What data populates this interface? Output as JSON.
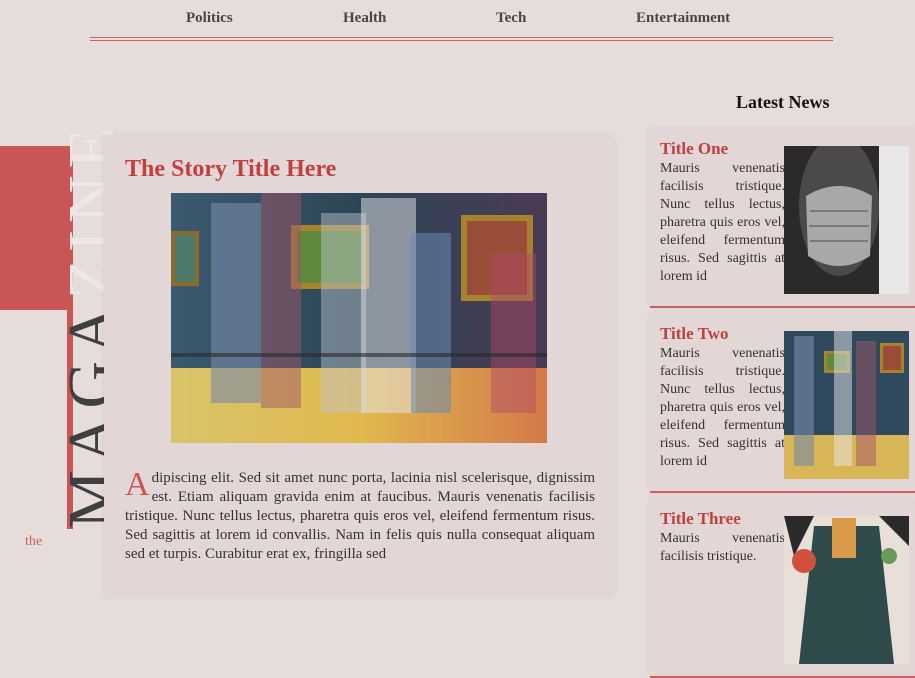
{
  "nav": {
    "items": [
      {
        "label": "Politics"
      },
      {
        "label": "Health"
      },
      {
        "label": "Tech"
      },
      {
        "label": "Entertainment"
      }
    ]
  },
  "masthead": {
    "word_dark": "MAGA",
    "word_light": "ZINE",
    "the": "the"
  },
  "story": {
    "title": "The Story Title Here",
    "dropcap": "A",
    "text": "dipiscing elit. Sed sit amet nunc porta, lacinia nisl scelerisque, dignissim est. Etiam aliquam gravida enim at faucibus. Mauris venenatis facilisis tristique. Nunc tellus lectus, pharetra quis eros vel, eleifend fermentum risus. Sed sagittis at lorem id convallis. Nam in felis quis nulla consequat aliquam sed et turpis. Curabitur erat ex, fringilla sed"
  },
  "sidebar": {
    "heading": "Latest News",
    "items": [
      {
        "title": "Title One",
        "body": "Mauris venenatis facilisis tristique. Nunc tellus lectus, pharetra quis eros vel, eleifend fermentum risus. Sed sagittis at lorem id"
      },
      {
        "title": "Title Two",
        "body": "Mauris venenatis facilisis tristique. Nunc tellus lectus, pharetra quis eros vel, eleifend fermentum risus. Sed sagittis at lorem id"
      },
      {
        "title": "Title Three",
        "body": "Mauris venenatis facilisis tristique."
      }
    ]
  },
  "colors": {
    "accent": "#c95655",
    "title": "#c0403f",
    "background": "#e6dcdc"
  }
}
